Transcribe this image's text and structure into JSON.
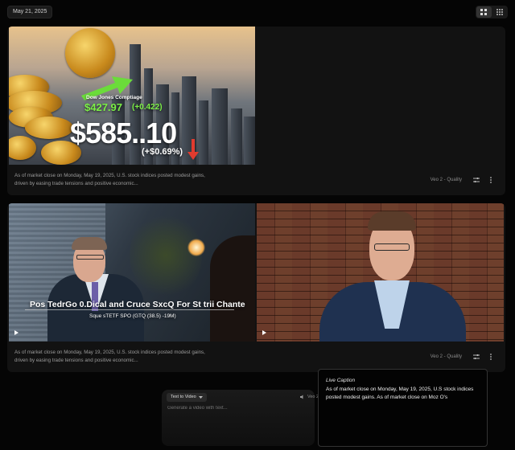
{
  "header": {
    "date": "May 21, 2025"
  },
  "cards": [
    {
      "thumbnail": {
        "index_name": "Dow Jones Comptiage",
        "index_value": "$427.97",
        "index_change": "(+0.422)",
        "big_value": "$585..10",
        "big_change": "(+$0.69%)"
      },
      "caption": "As of market close on Monday, May 19, 2025, U.S. stock indices posted modest gains, driven by easing trade tensions and positive economic...",
      "model": "Veo 2 - Quality"
    },
    {
      "thumbnail_a": {
        "headline": "Pos TedrGo 0.Dical and Cruce  SxcQ For St trii Chante",
        "subline": "Sque sTETF SPO  (GTQ (38.5) -19M)"
      },
      "caption": "As of market close on Monday, May 19, 2025, U.S. stock indices posted modest gains, driven by easing trade tensions and positive economic...",
      "model": "Veo 2 - Quality"
    }
  ],
  "composer": {
    "mode": "Text to Video",
    "placeholder": "Generate a video with text...",
    "model": "Veo 2"
  },
  "live_caption": {
    "title": "Live Caption",
    "text": "As of market close on Monday, May 19, 2025, U.S stock indices posted modest gains. As of market close on Moz O's"
  },
  "colors": {
    "background": "#050505",
    "card": "#121212",
    "green": "#6bdc3a",
    "red": "#e23b2e"
  }
}
